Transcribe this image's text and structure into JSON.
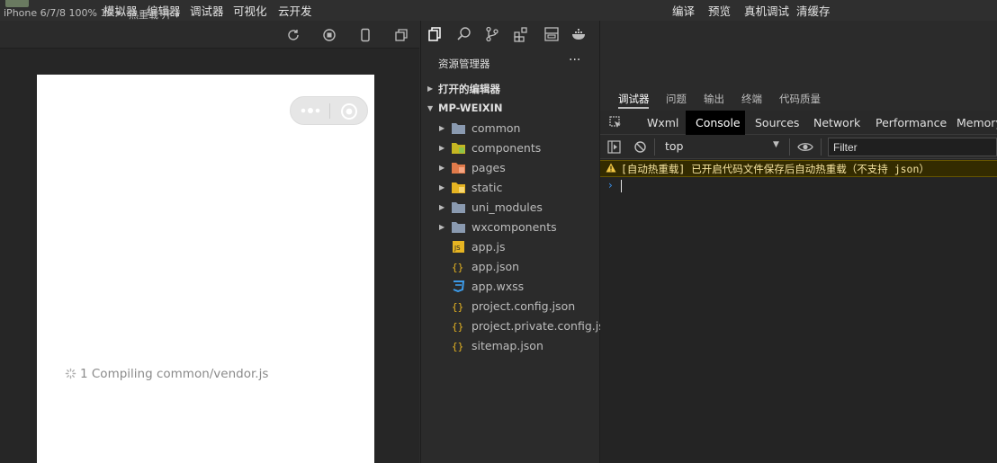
{
  "topbar": {
    "left_menu": [
      "模拟器",
      "编辑器",
      "调试器",
      "可视化",
      "云开发"
    ],
    "right_menu": [
      "编译",
      "预览",
      "真机调试",
      "清缓存"
    ]
  },
  "simulator": {
    "device": "iPhone 6/7/8 100% 16 ▾",
    "hot_reload": "热重载 开 ▾",
    "compiling_text": "1 Compiling common/vendor.js"
  },
  "explorer": {
    "title": "资源管理器",
    "more": "···",
    "open_editors": "打开的编辑器",
    "project": "MP-WEIXIN",
    "items": [
      {
        "name": "common",
        "type": "folder"
      },
      {
        "name": "components",
        "type": "folder"
      },
      {
        "name": "pages",
        "type": "folder"
      },
      {
        "name": "static",
        "type": "folder"
      },
      {
        "name": "uni_modules",
        "type": "folder"
      },
      {
        "name": "wxcomponents",
        "type": "folder"
      },
      {
        "name": "app.js",
        "type": "js"
      },
      {
        "name": "app.json",
        "type": "json"
      },
      {
        "name": "app.wxss",
        "type": "wxss"
      },
      {
        "name": "project.config.json",
        "type": "json"
      },
      {
        "name": "project.private.config.js...",
        "type": "json"
      },
      {
        "name": "sitemap.json",
        "type": "json"
      }
    ]
  },
  "devtools": {
    "tabs": [
      "调试器",
      "问题",
      "输出",
      "终端",
      "代码质量"
    ],
    "panels": [
      "Wxml",
      "Console",
      "Sources",
      "Network",
      "Performance",
      "Memory"
    ],
    "context": "top",
    "filter_placeholder": "Filter",
    "warning": "[自动热重载] 已开启代码文件保存后自动热重载（不支持 json）",
    "prompt": "›"
  }
}
